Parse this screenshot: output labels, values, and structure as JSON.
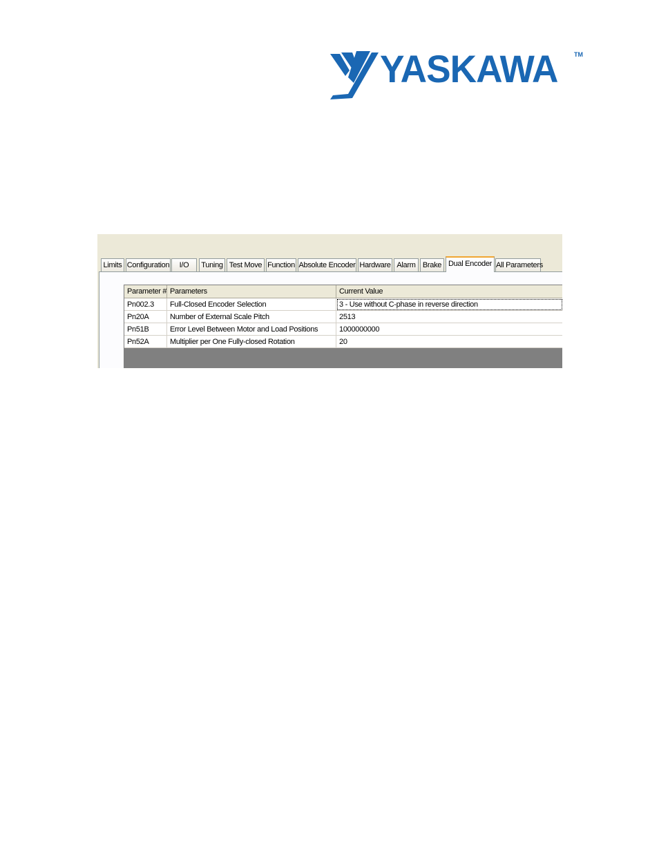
{
  "logo": {
    "text": "YASKAWA",
    "tm": "TM",
    "color": "#1a67b3"
  },
  "tabs": [
    {
      "label": "Limits",
      "active": false
    },
    {
      "label": "Configuration",
      "active": false
    },
    {
      "label": "I/O",
      "active": false
    },
    {
      "label": "Tuning",
      "active": false
    },
    {
      "label": "Test Move",
      "active": false
    },
    {
      "label": "Function",
      "active": false
    },
    {
      "label": "Absolute Encoder",
      "active": false
    },
    {
      "label": "Hardware",
      "active": false
    },
    {
      "label": "Alarm",
      "active": false
    },
    {
      "label": "Brake",
      "active": false
    },
    {
      "label": "Dual Encoder",
      "active": true
    },
    {
      "label": "All Parameters",
      "active": false
    }
  ],
  "table": {
    "columns": [
      "Parameter #",
      "Parameters",
      "Current Value"
    ],
    "rows": [
      {
        "param": "Pn002.3",
        "name": "Full-Closed Encoder Selection",
        "value": "3 - Use without C-phase in reverse direction"
      },
      {
        "param": "Pn20A",
        "name": "Number of External Scale Pitch",
        "value": "2513"
      },
      {
        "param": "Pn51B",
        "name": "Error Level Between Motor and Load Positions",
        "value": "1000000000"
      },
      {
        "param": "Pn52A",
        "name": "Multiplier per One Fully-closed Rotation",
        "value": "20"
      }
    ]
  }
}
